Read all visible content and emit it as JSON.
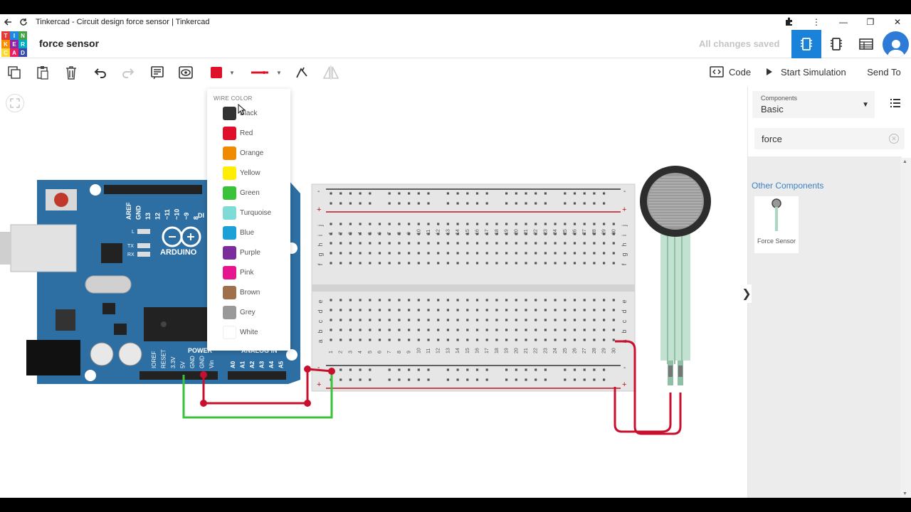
{
  "browser": {
    "window_title": "Tinkercad - Circuit design force sensor | Tinkercad"
  },
  "app": {
    "logo_letters": [
      "T",
      "I",
      "N",
      "K",
      "E",
      "R",
      "C",
      "A",
      "D"
    ],
    "logo_colors": [
      "#e53935",
      "#1e88e5",
      "#43a047",
      "#fb8c00",
      "#8e24aa",
      "#00acc1",
      "#fdd835",
      "#e91e63",
      "#3949ab"
    ],
    "project_title": "force sensor",
    "save_status": "All changes saved",
    "accent_color": "#1a82d9"
  },
  "toolbar": {
    "tools": [
      "copy-icon",
      "paste-icon",
      "delete-icon",
      "undo-icon",
      "redo-icon",
      "notes-icon",
      "visibility-icon",
      "wire-color-picker",
      "wire-type-picker",
      "rotate-icon",
      "flip-icon"
    ],
    "selected_wire_color": "#e0102a",
    "code_label": "Code",
    "simulation_label": "Start Simulation",
    "send_to_label": "Send To"
  },
  "wire_color_menu": {
    "title": "WIRE COLOR",
    "colors": [
      {
        "label": "Black",
        "hex": "#333333"
      },
      {
        "label": "Red",
        "hex": "#e0102a"
      },
      {
        "label": "Orange",
        "hex": "#f08a00"
      },
      {
        "label": "Yellow",
        "hex": "#ffee00"
      },
      {
        "label": "Green",
        "hex": "#3ac23a"
      },
      {
        "label": "Turquoise",
        "hex": "#7edbd6"
      },
      {
        "label": "Blue",
        "hex": "#1ca0d8"
      },
      {
        "label": "Purple",
        "hex": "#7b2d9b"
      },
      {
        "label": "Pink",
        "hex": "#e6158e"
      },
      {
        "label": "Brown",
        "hex": "#a0704c"
      },
      {
        "label": "Grey",
        "hex": "#999999"
      },
      {
        "label": "White",
        "hex": "#ffffff"
      }
    ]
  },
  "arduino": {
    "brand": "ARDUINO",
    "header_labels": [
      "AREF",
      "GND",
      "13",
      "12",
      "~11",
      "~10",
      "~9",
      "8"
    ],
    "led_labels": [
      "L",
      "TX",
      "RX"
    ],
    "power_header": "POWER",
    "analog_header": "ANALOG IN",
    "power_pins": [
      "IOREF",
      "RESET",
      "3.3V",
      "5V",
      "GND",
      "GND",
      "Vin"
    ],
    "analog_pins": [
      "A0",
      "A1",
      "A2",
      "A3",
      "A4",
      "A5"
    ],
    "partial_label": "DI"
  },
  "breadboard": {
    "rail_minus": "-",
    "rail_plus": "+",
    "column_numbers": [
      "1",
      "2",
      "3",
      "4",
      "5",
      "6",
      "7",
      "8",
      "9",
      "10",
      "11",
      "12",
      "13",
      "14",
      "15",
      "16",
      "17",
      "18",
      "19",
      "20",
      "21",
      "22",
      "23",
      "24",
      "25",
      "26",
      "27",
      "28",
      "29",
      "30"
    ],
    "top_rows": [
      "j",
      "i",
      "h",
      "g",
      "f"
    ],
    "bottom_rows": [
      "e",
      "d",
      "c",
      "b",
      "a"
    ]
  },
  "side_panel": {
    "dropdown_label": "Components",
    "dropdown_value": "Basic",
    "search_value": "force",
    "search_clear": "✕",
    "section_heading": "Other Components",
    "results": [
      {
        "label": "Force Sensor",
        "icon": "force-sensor-icon"
      }
    ],
    "collapse_glyph": "❯"
  }
}
